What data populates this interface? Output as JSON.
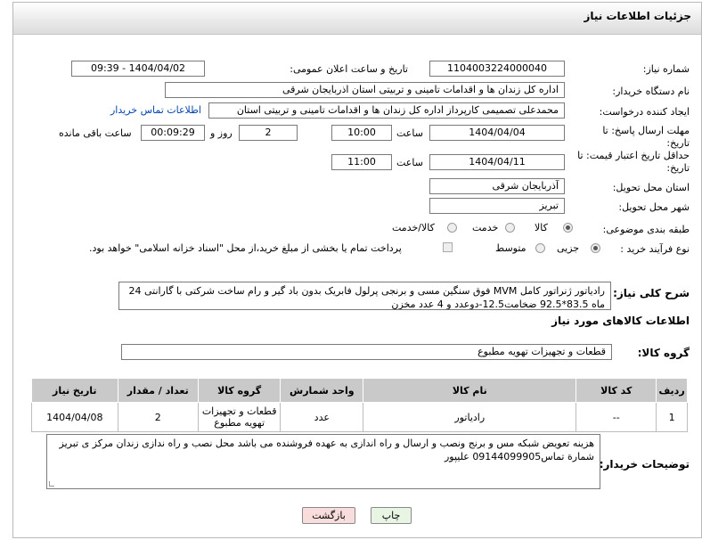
{
  "header": {
    "title": "جزئیات اطلاعات نیاز"
  },
  "fields": {
    "need_number_label": "شماره نیاز:",
    "need_number": "1104003224000040",
    "announce_label": "تاریخ و ساعت اعلان عمومی:",
    "announce_value": "1404/04/02 - 09:39",
    "buyer_org_label": "نام دستگاه خریدار:",
    "buyer_org": "اداره کل زندان ها و اقدامات تامینی و تربیتی استان اذربایجان شرقی",
    "creator_label": "ایجاد کننده درخواست:",
    "creator": "محمدعلی تصمیمی کارپرداز اداره کل زندان ها و اقدامات تامینی و تربیتی استان",
    "contact_link": "اطلاعات تماس خریدار",
    "deadline_label": "مهلت ارسال پاسخ: تا تاریخ:",
    "deadline_date": "1404/04/04",
    "time_label": "ساعت",
    "deadline_time": "10:00",
    "days_value": "2",
    "days_label": "روز و",
    "remaining_time": "00:09:29",
    "remaining_label": "ساعت باقی مانده",
    "price_validity_label": "حداقل تاریخ اعتبار قیمت: تا تاریخ:",
    "price_validity_date": "1404/04/11",
    "price_validity_time": "11:00",
    "province_label": "استان محل تحویل:",
    "province": "آذربایجان شرقی",
    "city_label": "شهر محل تحویل:",
    "city": "تبریز",
    "category_label": "طبقه بندی موضوعی:",
    "category_options": [
      "کالا",
      "خدمت",
      "کالا/خدمت"
    ],
    "process_label": "نوع فرآیند خرید :",
    "process_options": [
      "جزیی",
      "متوسط"
    ],
    "payment_text": "پرداخت تمام یا بخشی از مبلغ خرید،از محل \"اسناد خزانه اسلامی\" خواهد بود."
  },
  "description": {
    "label": "شرح کلی نیاز:",
    "text": "رادیاتور ژنراتور کامل MVM فوق سنگین مسی و برنجی پرلول فابریک بدون باد گیر و رام ساخت شرکتی با گارانتی 24 ماه 83.5*92.5 ضخامت12.5-دوعدد و 4 عدد مخزن"
  },
  "goods": {
    "section_title": "اطلاعات کالاهای مورد نیاز",
    "group_label": "گروه کالا:",
    "group_value": "قطعات و تجهیزات تهویه مطبوع",
    "columns": [
      "ردیف",
      "کد کالا",
      "نام کالا",
      "واحد شمارش",
      "گروه کالا",
      "تعداد / مقدار",
      "تاریخ نیاز"
    ],
    "rows": [
      [
        "1",
        "--",
        "رادیاتور",
        "عدد",
        "قطعات و تجهیزات تهویه مطبوع",
        "2",
        "1404/04/08"
      ]
    ]
  },
  "buyer_notes": {
    "label": "توضیحات خریدار:",
    "text": "هزینه تعویض شبکه مس و برنج ونصب و ارسال و راه اندازی به عهده فروشنده می باشد محل نصب و راه ندازی زندان مرکز ی تبریز شمارة تماس09144099905 علیپور"
  },
  "buttons": {
    "print": "چاپ",
    "back": "بازگشت"
  },
  "colors": {
    "back_button_bg": "#f9dcdc",
    "print_button_bg": "#e9f5e3",
    "table_header_bg": "#c9c9c9",
    "link": "#0645ad"
  }
}
